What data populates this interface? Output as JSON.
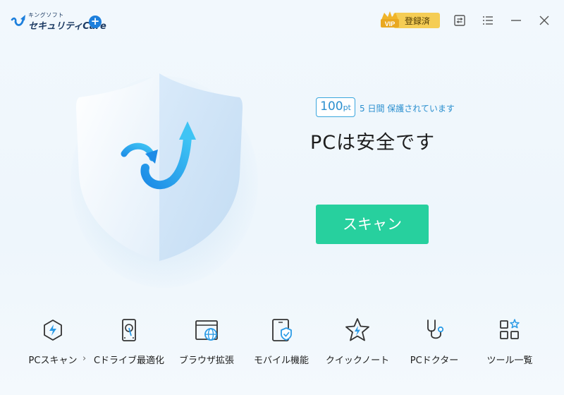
{
  "app": {
    "logo_small": "キングソフト",
    "logo_main": "セキュリティCare"
  },
  "vip": {
    "badge_text": "VIP",
    "label": "登録済"
  },
  "status": {
    "points_value": "100",
    "points_unit": "pt",
    "protected_text": "5 日間 保護されています",
    "headline": "PCは安全です"
  },
  "scan_button": {
    "label": "スキャン"
  },
  "tools": [
    {
      "label": "PCスキャン",
      "icon": "bolt-hexagon-icon"
    },
    {
      "label": "Cドライブ最適化",
      "icon": "hard-drive-icon"
    },
    {
      "label": "ブラウザ拡張",
      "icon": "browser-globe-icon"
    },
    {
      "label": "モバイル機能",
      "icon": "phone-shield-icon"
    },
    {
      "label": "クイックノート",
      "icon": "star-bolt-icon"
    },
    {
      "label": "PCドクター",
      "icon": "stethoscope-icon"
    },
    {
      "label": "ツール一覧",
      "icon": "grid-tools-icon"
    }
  ],
  "colors": {
    "accent": "#27d09e",
    "brand_blue": "#1d7fdc",
    "vip_gold": "#f5cd55"
  }
}
